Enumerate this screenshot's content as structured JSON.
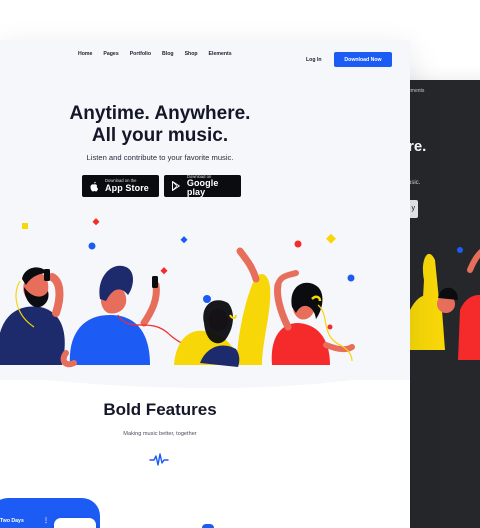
{
  "nav": {
    "links": [
      "Home",
      "Pages",
      "Portfolio",
      "Blog",
      "Shop",
      "Elements"
    ],
    "login": "Log In",
    "cta": "Download Now"
  },
  "hero": {
    "title_line1": "Anytime. Anywhere.",
    "title_line2": "All your music.",
    "subtitle": "Listen and contribute to your favorite music.",
    "app_store": {
      "small": "Download on the",
      "big": "App Store"
    },
    "google_play": {
      "small": "Download on",
      "big": "Google play"
    }
  },
  "dark_preview": {
    "nav_text": "ements",
    "title_fragment": "re.",
    "subtitle_fragment": "usic.",
    "button_fragment": "y"
  },
  "features": {
    "title": "Bold Features",
    "subtitle": "Making music better, together"
  },
  "phone": {
    "tab_label": "Two Days",
    "menu_glyph": "⋮"
  },
  "colors": {
    "accent": "#1c5cf5",
    "dark": "#141728",
    "yellow": "#f7d708",
    "red": "#f52b2b",
    "skin": "#e86e5c"
  },
  "icons": [
    "apple-icon",
    "google-play-icon",
    "pulse-icon",
    "menu-dots-icon"
  ]
}
